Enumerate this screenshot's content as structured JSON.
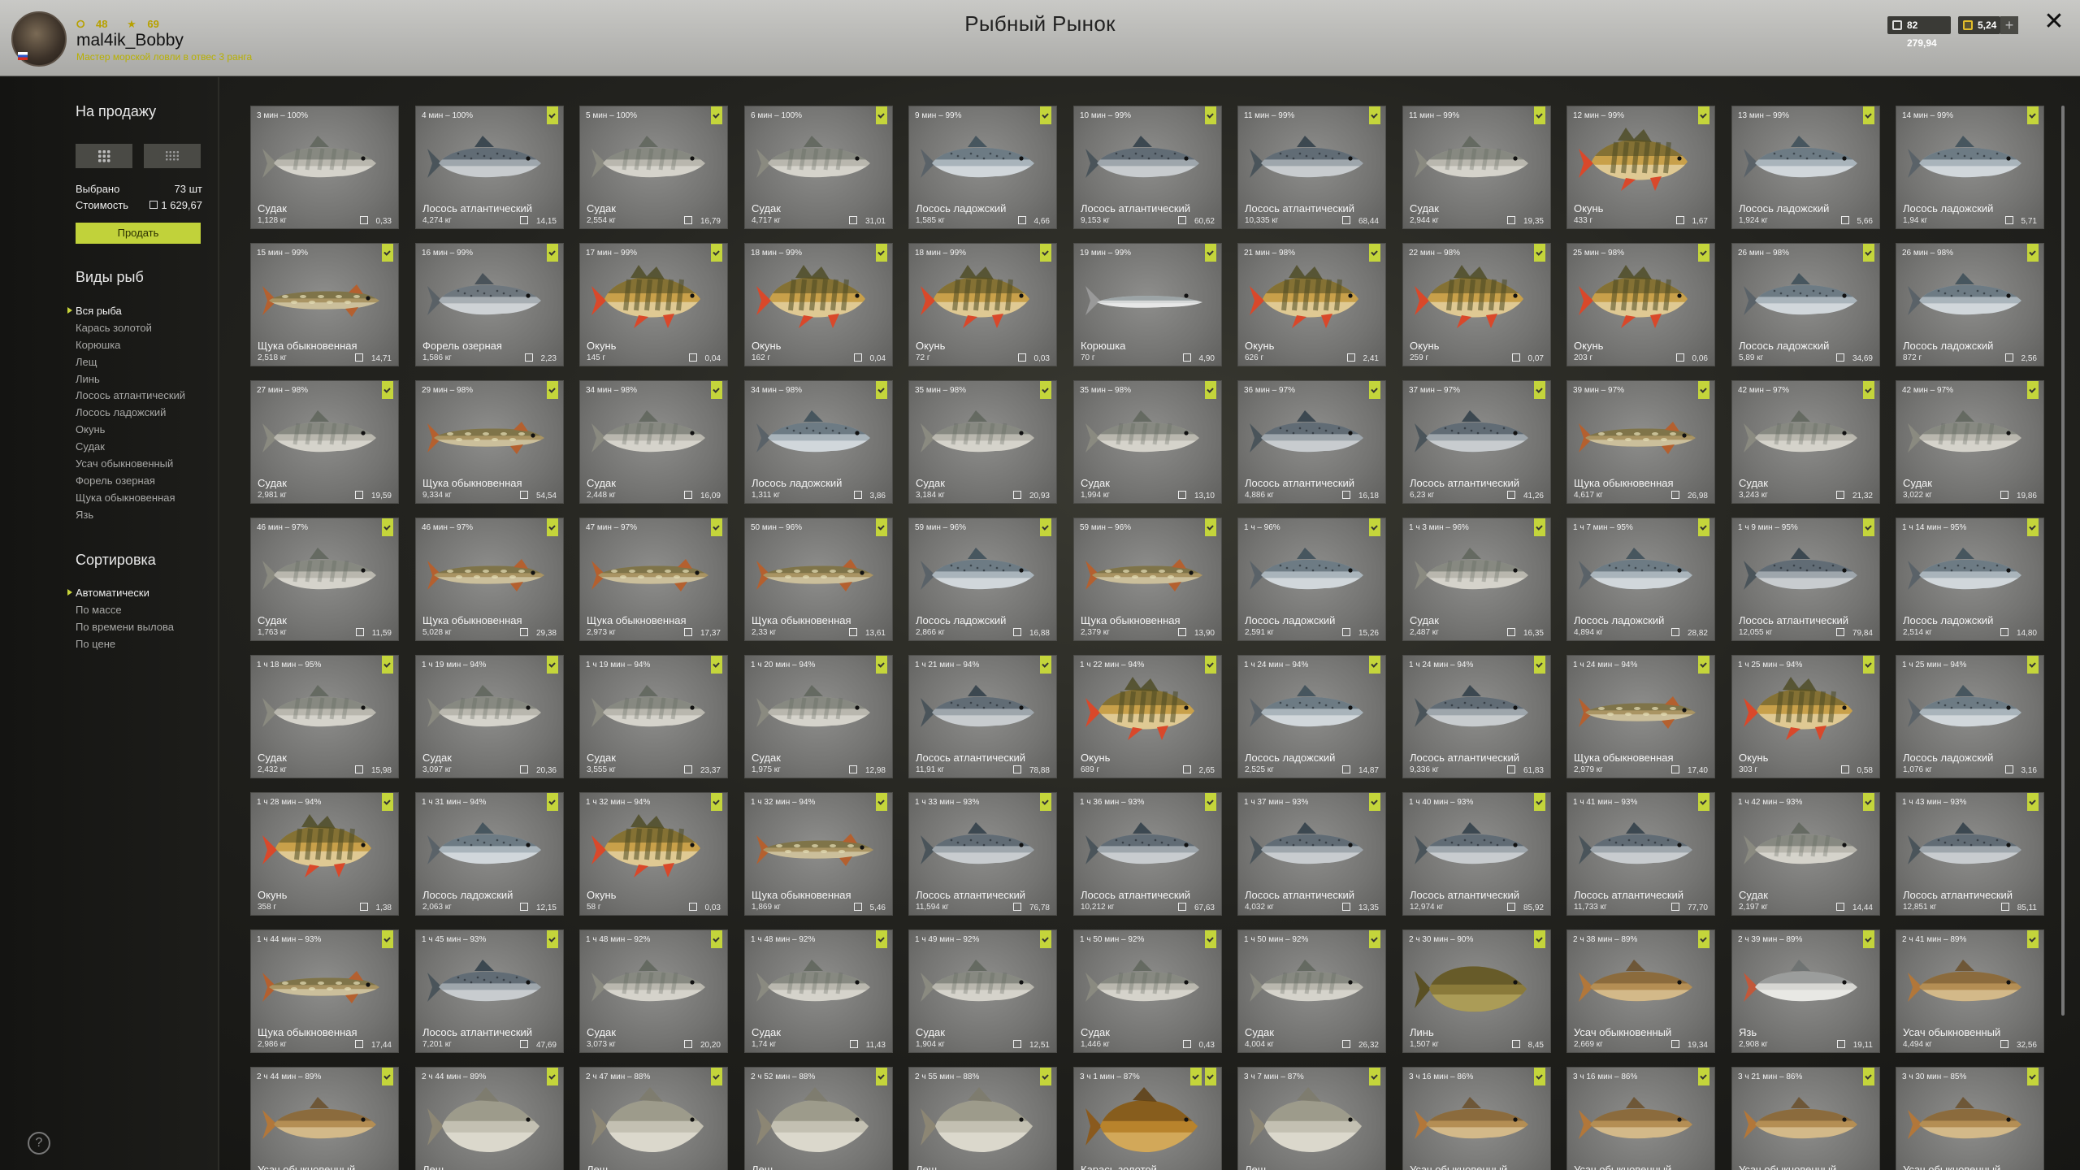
{
  "header": {
    "level": "48",
    "stars": "69",
    "username": "mal4ik_Bobby",
    "rank": "Мастер морской ловли в отвес 3 ранга",
    "title": "Рыбный Рынок",
    "silver": "82 279,94",
    "gold": "5,24",
    "add_label": "+",
    "close_label": "✕"
  },
  "sidebar": {
    "for_sale_title": "На продажу",
    "selected_label": "Выбрано",
    "selected_value": "73 шт",
    "cost_label": "Стоимость",
    "cost_value": "1 629,67",
    "sell_label": "Продать",
    "species_title": "Виды рыб",
    "species": [
      "Вся рыба",
      "Карась золотой",
      "Корюшка",
      "Лещ",
      "Линь",
      "Лосось атлантический",
      "Лосось ладожский",
      "Окунь",
      "Судак",
      "Усач обыкновенный",
      "Форель озерная",
      "Щука обыкновенная",
      "Язь"
    ],
    "sort_title": "Сортировка",
    "sorts": [
      "Автоматически",
      "По массе",
      "По времени вылова",
      "По цене"
    ],
    "help_label": "?"
  },
  "fish_palette": {
    "Судак": {
      "body": "#b9b7ae",
      "back": "#5f655c",
      "belly": "#e8e6dd",
      "fin": "#8a8a80",
      "kind": "zander"
    },
    "Лосось атлантический": {
      "body": "#9ea6ac",
      "back": "#2f3d48",
      "belly": "#e4e6e6",
      "fin": "#4a545a",
      "kind": "salmon"
    },
    "Лосось ладожский": {
      "body": "#a9b4bb",
      "back": "#3c4d58",
      "belly": "#eceff0",
      "fin": "#5a6268",
      "kind": "salmon"
    },
    "Окунь": {
      "body": "#c8a04a",
      "back": "#4c4a22",
      "belly": "#efe4c4",
      "fin": "#d9482a",
      "kind": "perch"
    },
    "Щука обыкновенная": {
      "body": "#a99463",
      "back": "#5c5a34",
      "belly": "#e3dcc2",
      "fin": "#b4602f",
      "kind": "pike"
    },
    "Форель озерная": {
      "body": "#a7aeb3",
      "back": "#3f4a52",
      "belly": "#e8eaeb",
      "fin": "#5a6166",
      "kind": "salmon"
    },
    "Корюшка": {
      "body": "#d6d8d8",
      "back": "#6e7a7e",
      "belly": "#f2f2f2",
      "fin": "#999",
      "kind": "smelt"
    },
    "Линь": {
      "body": "#8a7a3a",
      "back": "#4a421c",
      "belly": "#c2b36a",
      "fin": "#5a5024",
      "kind": "tench"
    },
    "Усач обыкновенный": {
      "body": "#b48e54",
      "back": "#6a4f2a",
      "belly": "#e8d5ae",
      "fin": "#b2773a",
      "kind": "barbel"
    },
    "Язь": {
      "body": "#d6d6d2",
      "back": "#6b7070",
      "belly": "#f3f3f0",
      "fin": "#c2583a",
      "kind": "ide"
    },
    "Лещ": {
      "body": "#c3c0b2",
      "back": "#7e7b6c",
      "belly": "#ebe8de",
      "fin": "#8c8674",
      "kind": "bream"
    },
    "Карась золотой": {
      "body": "#b8832c",
      "back": "#5e3e12",
      "belly": "#e2c178",
      "fin": "#8a5a1e",
      "kind": "carp"
    }
  },
  "cards": [
    {
      "time": "3 мин – 100%",
      "name": "Судак",
      "weight": "1,128 кг",
      "price": "0,33",
      "marks": 0
    },
    {
      "time": "4 мин – 100%",
      "name": "Лосось атлантический",
      "weight": "4,274 кг",
      "price": "14,15",
      "marks": 1
    },
    {
      "time": "5 мин – 100%",
      "name": "Судак",
      "weight": "2,554 кг",
      "price": "16,79",
      "marks": 1
    },
    {
      "time": "6 мин – 100%",
      "name": "Судак",
      "weight": "4,717 кг",
      "price": "31,01",
      "marks": 1
    },
    {
      "time": "9 мин – 99%",
      "name": "Лосось ладожский",
      "weight": "1,585 кг",
      "price": "4,66",
      "marks": 1
    },
    {
      "time": "10 мин – 99%",
      "name": "Лосось атлантический",
      "weight": "9,153 кг",
      "price": "60,62",
      "marks": 1
    },
    {
      "time": "11 мин – 99%",
      "name": "Лосось атлантический",
      "weight": "10,335 кг",
      "price": "68,44",
      "marks": 1
    },
    {
      "time": "11 мин – 99%",
      "name": "Судак",
      "weight": "2,944 кг",
      "price": "19,35",
      "marks": 1
    },
    {
      "time": "12 мин – 99%",
      "name": "Окунь",
      "weight": "433 г",
      "price": "1,67",
      "marks": 1
    },
    {
      "time": "13 мин – 99%",
      "name": "Лосось ладожский",
      "weight": "1,924 кг",
      "price": "5,66",
      "marks": 1
    },
    {
      "time": "14 мин – 99%",
      "name": "Лосось ладожский",
      "weight": "1,94 кг",
      "price": "5,71",
      "marks": 1
    },
    {
      "time": "15 мин – 99%",
      "name": "Щука обыкновенная",
      "weight": "2,518 кг",
      "price": "14,71",
      "marks": 1
    },
    {
      "time": "16 мин – 99%",
      "name": "Форель озерная",
      "weight": "1,586 кг",
      "price": "2,23",
      "marks": 1
    },
    {
      "time": "17 мин – 99%",
      "name": "Окунь",
      "weight": "145 г",
      "price": "0,04",
      "marks": 1
    },
    {
      "time": "18 мин – 99%",
      "name": "Окунь",
      "weight": "162 г",
      "price": "0,04",
      "marks": 1
    },
    {
      "time": "18 мин – 99%",
      "name": "Окунь",
      "weight": "72 г",
      "price": "0,03",
      "marks": 1
    },
    {
      "time": "19 мин – 99%",
      "name": "Корюшка",
      "weight": "70 г",
      "price": "4,90",
      "marks": 1
    },
    {
      "time": "21 мин – 98%",
      "name": "Окунь",
      "weight": "626 г",
      "price": "2,41",
      "marks": 1
    },
    {
      "time": "22 мин – 98%",
      "name": "Окунь",
      "weight": "259 г",
      "price": "0,07",
      "marks": 1
    },
    {
      "time": "25 мин – 98%",
      "name": "Окунь",
      "weight": "203 г",
      "price": "0,06",
      "marks": 1
    },
    {
      "time": "26 мин – 98%",
      "name": "Лосось ладожский",
      "weight": "5,89 кг",
      "price": "34,69",
      "marks": 1
    },
    {
      "time": "26 мин – 98%",
      "name": "Лосось ладожский",
      "weight": "872 г",
      "price": "2,56",
      "marks": 1
    },
    {
      "time": "27 мин – 98%",
      "name": "Судак",
      "weight": "2,981 кг",
      "price": "19,59",
      "marks": 1
    },
    {
      "time": "29 мин – 98%",
      "name": "Щука обыкновенная",
      "weight": "9,334 кг",
      "price": "54,54",
      "marks": 1
    },
    {
      "time": "34 мин – 98%",
      "name": "Судак",
      "weight": "2,448 кг",
      "price": "16,09",
      "marks": 1
    },
    {
      "time": "34 мин – 98%",
      "name": "Лосось ладожский",
      "weight": "1,311 кг",
      "price": "3,86",
      "marks": 1
    },
    {
      "time": "35 мин – 98%",
      "name": "Судак",
      "weight": "3,184 кг",
      "price": "20,93",
      "marks": 1
    },
    {
      "time": "35 мин – 98%",
      "name": "Судак",
      "weight": "1,994 кг",
      "price": "13,10",
      "marks": 1
    },
    {
      "time": "36 мин – 97%",
      "name": "Лосось атлантический",
      "weight": "4,886 кг",
      "price": "16,18",
      "marks": 1
    },
    {
      "time": "37 мин – 97%",
      "name": "Лосось атлантический",
      "weight": "6,23 кг",
      "price": "41,26",
      "marks": 1
    },
    {
      "time": "39 мин – 97%",
      "name": "Щука обыкновенная",
      "weight": "4,617 кг",
      "price": "26,98",
      "marks": 1
    },
    {
      "time": "42 мин – 97%",
      "name": "Судак",
      "weight": "3,243 кг",
      "price": "21,32",
      "marks": 1
    },
    {
      "time": "42 мин – 97%",
      "name": "Судак",
      "weight": "3,022 кг",
      "price": "19,86",
      "marks": 1
    },
    {
      "time": "46 мин – 97%",
      "name": "Судак",
      "weight": "1,763 кг",
      "price": "11,59",
      "marks": 1
    },
    {
      "time": "46 мин – 97%",
      "name": "Щука обыкновенная",
      "weight": "5,028 кг",
      "price": "29,38",
      "marks": 1
    },
    {
      "time": "47 мин – 97%",
      "name": "Щука обыкновенная",
      "weight": "2,973 кг",
      "price": "17,37",
      "marks": 1
    },
    {
      "time": "50 мин – 96%",
      "name": "Щука обыкновенная",
      "weight": "2,33 кг",
      "price": "13,61",
      "marks": 1
    },
    {
      "time": "59 мин – 96%",
      "name": "Лосось ладожский",
      "weight": "2,866 кг",
      "price": "16,88",
      "marks": 1
    },
    {
      "time": "59 мин – 96%",
      "name": "Щука обыкновенная",
      "weight": "2,379 кг",
      "price": "13,90",
      "marks": 1
    },
    {
      "time": "1 ч – 96%",
      "name": "Лосось ладожский",
      "weight": "2,591 кг",
      "price": "15,26",
      "marks": 1
    },
    {
      "time": "1 ч 3 мин – 96%",
      "name": "Судак",
      "weight": "2,487 кг",
      "price": "16,35",
      "marks": 1
    },
    {
      "time": "1 ч 7 мин – 95%",
      "name": "Лосось ладожский",
      "weight": "4,894 кг",
      "price": "28,82",
      "marks": 1
    },
    {
      "time": "1 ч 9 мин – 95%",
      "name": "Лосось атлантический",
      "weight": "12,055 кг",
      "price": "79,84",
      "marks": 1
    },
    {
      "time": "1 ч 14 мин – 95%",
      "name": "Лосось ладожский",
      "weight": "2,514 кг",
      "price": "14,80",
      "marks": 1
    },
    {
      "time": "1 ч 18 мин – 95%",
      "name": "Судак",
      "weight": "2,432 кг",
      "price": "15,98",
      "marks": 1
    },
    {
      "time": "1 ч 19 мин – 94%",
      "name": "Судак",
      "weight": "3,097 кг",
      "price": "20,36",
      "marks": 1
    },
    {
      "time": "1 ч 19 мин – 94%",
      "name": "Судак",
      "weight": "3,555 кг",
      "price": "23,37",
      "marks": 1
    },
    {
      "time": "1 ч 20 мин – 94%",
      "name": "Судак",
      "weight": "1,975 кг",
      "price": "12,98",
      "marks": 1
    },
    {
      "time": "1 ч 21 мин – 94%",
      "name": "Лосось атлантический",
      "weight": "11,91 кг",
      "price": "78,88",
      "marks": 1
    },
    {
      "time": "1 ч 22 мин – 94%",
      "name": "Окунь",
      "weight": "689 г",
      "price": "2,65",
      "marks": 1
    },
    {
      "time": "1 ч 24 мин – 94%",
      "name": "Лосось ладожский",
      "weight": "2,525 кг",
      "price": "14,87",
      "marks": 1
    },
    {
      "time": "1 ч 24 мин – 94%",
      "name": "Лосось атлантический",
      "weight": "9,336 кг",
      "price": "61,83",
      "marks": 1
    },
    {
      "time": "1 ч 24 мин – 94%",
      "name": "Щука обыкновенная",
      "weight": "2,979 кг",
      "price": "17,40",
      "marks": 1
    },
    {
      "time": "1 ч 25 мин – 94%",
      "name": "Окунь",
      "weight": "303 г",
      "price": "0,58",
      "marks": 1
    },
    {
      "time": "1 ч 25 мин – 94%",
      "name": "Лосось ладожский",
      "weight": "1,076 кг",
      "price": "3,16",
      "marks": 1
    },
    {
      "time": "1 ч 28 мин – 94%",
      "name": "Окунь",
      "weight": "358 г",
      "price": "1,38",
      "marks": 1
    },
    {
      "time": "1 ч 31 мин – 94%",
      "name": "Лосось ладожский",
      "weight": "2,063 кг",
      "price": "12,15",
      "marks": 1
    },
    {
      "time": "1 ч 32 мин – 94%",
      "name": "Окунь",
      "weight": "58 г",
      "price": "0,03",
      "marks": 1
    },
    {
      "time": "1 ч 32 мин – 94%",
      "name": "Щука обыкновенная",
      "weight": "1,869 кг",
      "price": "5,46",
      "marks": 1
    },
    {
      "time": "1 ч 33 мин – 93%",
      "name": "Лосось атлантический",
      "weight": "11,594 кг",
      "price": "76,78",
      "marks": 1
    },
    {
      "time": "1 ч 36 мин – 93%",
      "name": "Лосось атлантический",
      "weight": "10,212 кг",
      "price": "67,63",
      "marks": 1
    },
    {
      "time": "1 ч 37 мин – 93%",
      "name": "Лосось атлантический",
      "weight": "4,032 кг",
      "price": "13,35",
      "marks": 1
    },
    {
      "time": "1 ч 40 мин – 93%",
      "name": "Лосось атлантический",
      "weight": "12,974 кг",
      "price": "85,92",
      "marks": 1
    },
    {
      "time": "1 ч 41 мин – 93%",
      "name": "Лосось атлантический",
      "weight": "11,733 кг",
      "price": "77,70",
      "marks": 1
    },
    {
      "time": "1 ч 42 мин – 93%",
      "name": "Судак",
      "weight": "2,197 кг",
      "price": "14,44",
      "marks": 1
    },
    {
      "time": "1 ч 43 мин – 93%",
      "name": "Лосось атлантический",
      "weight": "12,851 кг",
      "price": "85,11",
      "marks": 1
    },
    {
      "time": "1 ч 44 мин – 93%",
      "name": "Щука обыкновенная",
      "weight": "2,986 кг",
      "price": "17,44",
      "marks": 1
    },
    {
      "time": "1 ч 45 мин – 93%",
      "name": "Лосось атлантический",
      "weight": "7,201 кг",
      "price": "47,69",
      "marks": 1
    },
    {
      "time": "1 ч 48 мин – 92%",
      "name": "Судак",
      "weight": "3,073 кг",
      "price": "20,20",
      "marks": 1
    },
    {
      "time": "1 ч 48 мин – 92%",
      "name": "Судак",
      "weight": "1,74 кг",
      "price": "11,43",
      "marks": 1
    },
    {
      "time": "1 ч 49 мин – 92%",
      "name": "Судак",
      "weight": "1,904 кг",
      "price": "12,51",
      "marks": 1
    },
    {
      "time": "1 ч 50 мин – 92%",
      "name": "Судак",
      "weight": "1,446 кг",
      "price": "0,43",
      "marks": 1
    },
    {
      "time": "1 ч 50 мин – 92%",
      "name": "Судак",
      "weight": "4,004 кг",
      "price": "26,32",
      "marks": 1
    },
    {
      "time": "2 ч 30 мин – 90%",
      "name": "Линь",
      "weight": "1,507 кг",
      "price": "8,45",
      "marks": 1
    },
    {
      "time": "2 ч 38 мин – 89%",
      "name": "Усач обыкновенный",
      "weight": "2,669 кг",
      "price": "19,34",
      "marks": 1
    },
    {
      "time": "2 ч 39 мин – 89%",
      "name": "Язь",
      "weight": "2,908 кг",
      "price": "19,11",
      "marks": 1
    },
    {
      "time": "2 ч 41 мин – 89%",
      "name": "Усач обыкновенный",
      "weight": "4,494 кг",
      "price": "32,56",
      "marks": 1
    },
    {
      "time": "2 ч 44 мин – 89%",
      "name": "Усач обыкновенный",
      "weight": "",
      "price": "",
      "marks": 1
    },
    {
      "time": "2 ч 44 мин – 89%",
      "name": "Лещ",
      "weight": "",
      "price": "",
      "marks": 1
    },
    {
      "time": "2 ч 47 мин – 88%",
      "name": "Лещ",
      "weight": "",
      "price": "",
      "marks": 1
    },
    {
      "time": "2 ч 52 мин – 88%",
      "name": "Лещ",
      "weight": "",
      "price": "",
      "marks": 1
    },
    {
      "time": "2 ч 55 мин – 88%",
      "name": "Лещ",
      "weight": "",
      "price": "",
      "marks": 1
    },
    {
      "time": "3 ч 1 мин – 87%",
      "name": "Карась золотой",
      "weight": "",
      "price": "",
      "marks": 2
    },
    {
      "time": "3 ч 7 мин – 87%",
      "name": "Лещ",
      "weight": "",
      "price": "",
      "marks": 1
    },
    {
      "time": "3 ч 16 мин – 86%",
      "name": "Усач обыкновенный",
      "weight": "",
      "price": "",
      "marks": 1
    },
    {
      "time": "3 ч 16 мин – 86%",
      "name": "Усач обыкновенный",
      "weight": "",
      "price": "",
      "marks": 1
    },
    {
      "time": "3 ч 21 мин – 86%",
      "name": "Усач обыкновенный",
      "weight": "",
      "price": "",
      "marks": 1
    },
    {
      "time": "3 ч 30 мин – 85%",
      "name": "Усач обыкновенный",
      "weight": "",
      "price": "",
      "marks": 1
    }
  ]
}
